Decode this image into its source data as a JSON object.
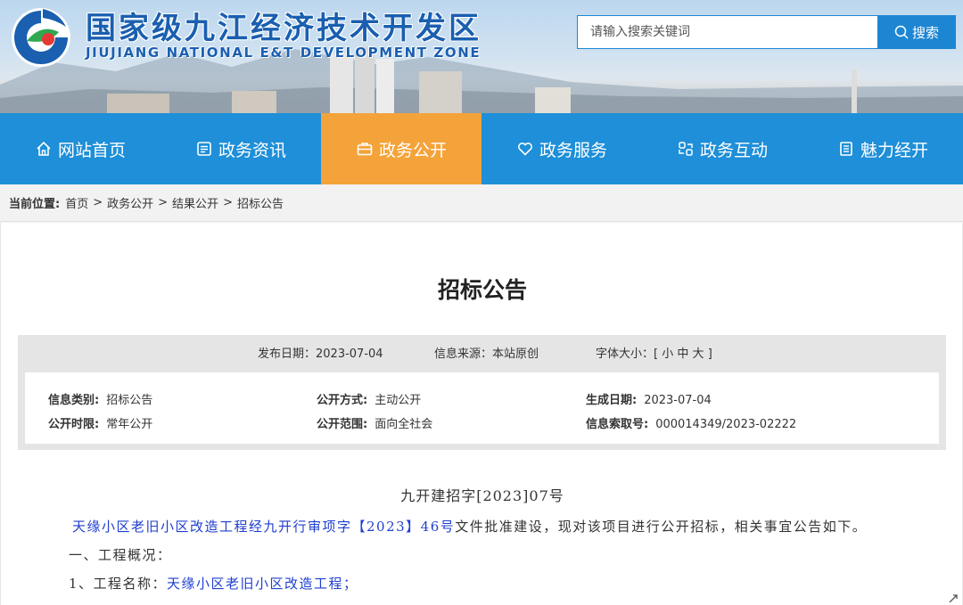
{
  "header": {
    "title": "国家级九江经济技术开发区",
    "subtitle": "JIUJIANG NATIONAL E&T DEVELOPMENT ZONE",
    "search_placeholder": "请输入搜索关键词",
    "search_label": "搜索"
  },
  "nav": {
    "items": [
      {
        "label": "网站首页",
        "icon": "home-icon"
      },
      {
        "label": "政务资讯",
        "icon": "news-icon"
      },
      {
        "label": "政务公开",
        "icon": "briefcase-icon",
        "active": true
      },
      {
        "label": "政务服务",
        "icon": "heart-icon"
      },
      {
        "label": "政务互动",
        "icon": "interaction-icon"
      },
      {
        "label": "魅力经开",
        "icon": "document-icon"
      }
    ],
    "active_color": "#f4a33a",
    "bar_color": "#1e8fd8"
  },
  "breadcrumb": {
    "label": "当前位置:",
    "items": [
      "首页",
      "政务公开",
      "结果公开",
      "招标公告"
    ],
    "separator": ">"
  },
  "article": {
    "title": "招标公告",
    "meta": {
      "publish_date": "发布日期：2023-07-04",
      "source": "信息来源：本站原创",
      "font_size_label": "字体大小：[",
      "font_small": "小",
      "font_medium": "中",
      "font_large": "大",
      "font_close": "]"
    },
    "info": {
      "category_label": "信息类别:",
      "category_value": "招标公告",
      "method_label": "公开方式:",
      "method_value": "主动公开",
      "gen_date_label": "生成日期:",
      "gen_date_value": "2023-07-04",
      "period_label": "公开时限:",
      "period_value": "常年公开",
      "scope_label": "公开范围:",
      "scope_value": "面向全社会",
      "index_label": "信息索取号:",
      "index_value": "000014349/2023-02222"
    },
    "doc_number": "九开建招字[2023]07号",
    "para1_blue": "天缘小区老旧小区改造工程经九开行审项字【2023】46号",
    "para1_rest": "文件批准建设，现对该项目进行公开招标，相关事宜公告如下。",
    "section1": "一、工程概况：",
    "item1_label": "1、工程名称：",
    "item1_value": "天缘小区老旧小区改造工程；"
  }
}
